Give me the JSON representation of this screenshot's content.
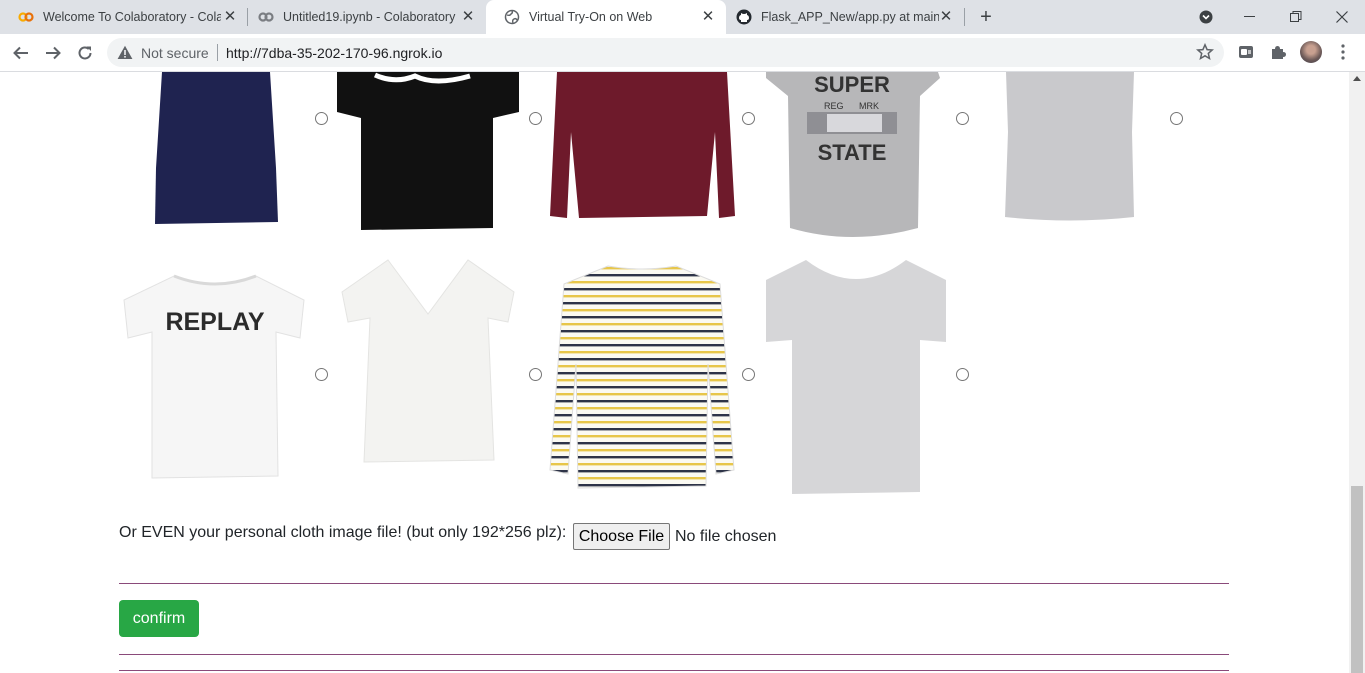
{
  "browser": {
    "tabs": [
      {
        "title": "Welcome To Colaboratory - Colab",
        "icon": "colab-icon",
        "active": false
      },
      {
        "title": "Untitled19.ipynb - Colaboratory",
        "icon": "colab-icon",
        "active": false
      },
      {
        "title": "Virtual Try-On on Web",
        "icon": "globe-icon",
        "active": true
      },
      {
        "title": "Flask_APP_New/app.py at main ·",
        "icon": "github-icon",
        "active": false
      }
    ],
    "new_tab": "+",
    "security_label": "Not secure",
    "url": "http://7dba-35-202-170-96.ngrok.io"
  },
  "gallery": {
    "row1": [
      {
        "name": "navy-tank-top",
        "color": "#1f2350"
      },
      {
        "name": "black-graphic-tee",
        "color": "#111111"
      },
      {
        "name": "burgundy-long-sleeve",
        "color": "#6e1a2b"
      },
      {
        "name": "grey-superstate-tee",
        "color": "#b7b7b9"
      },
      {
        "name": "grey-tank-top",
        "color": "#c9c9cc"
      }
    ],
    "row2": [
      {
        "name": "white-replay-tee",
        "color": "#f6f6f6",
        "print": "REPLAY"
      },
      {
        "name": "white-v-neck-tee",
        "color": "#f3f3f1"
      },
      {
        "name": "striped-long-sleeve",
        "color": "#fbfaf2"
      },
      {
        "name": "light-grey-tee",
        "color": "#d6d6d8"
      }
    ],
    "print_texts": {
      "super": "SUPER",
      "reg": "REG",
      "mrk": "MRK",
      "state": "STATE"
    }
  },
  "upload": {
    "label": "Or EVEN your personal cloth image file! (but only 192*256 plz):",
    "button": "Choose File",
    "status": "No file chosen"
  },
  "confirm_label": "confirm",
  "colors": {
    "accent": "#28a745",
    "divider": "#8a4a7a"
  }
}
